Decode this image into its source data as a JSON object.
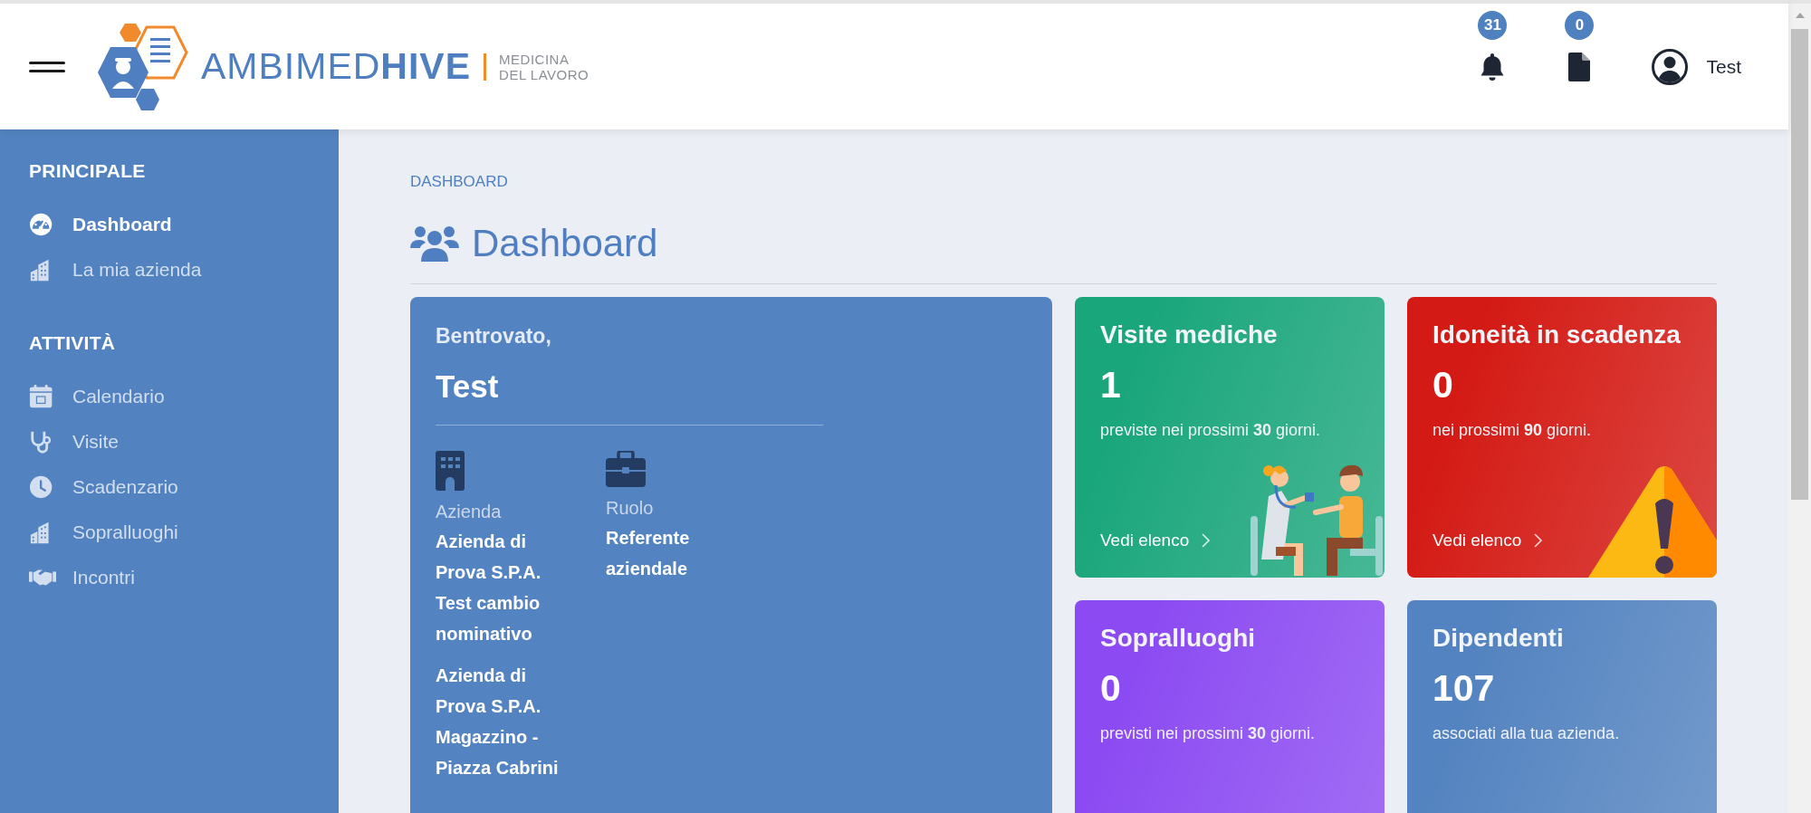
{
  "header": {
    "logo": {
      "brand_light": "AMBIMED",
      "brand_bold": "HIVE",
      "tagline_1": "MEDICINA",
      "tagline_2": "DEL LAVORO"
    },
    "notifications": {
      "count": "31"
    },
    "documents": {
      "count": "0"
    },
    "user": {
      "name": "Test"
    }
  },
  "sidebar": {
    "sections": [
      {
        "title": "PRINCIPALE",
        "items": [
          {
            "label": "Dashboard",
            "selected": true
          },
          {
            "label": "La mia azienda",
            "selected": false
          }
        ]
      },
      {
        "title": "ATTIVITÀ",
        "items": [
          {
            "label": "Calendario",
            "selected": false
          },
          {
            "label": "Visite",
            "selected": false
          },
          {
            "label": "Scadenzario",
            "selected": false
          },
          {
            "label": "Sopralluoghi",
            "selected": false
          },
          {
            "label": "Incontri",
            "selected": false
          }
        ]
      }
    ]
  },
  "breadcrumb": "DASHBOARD",
  "page_title": "Dashboard",
  "welcome": {
    "greeting": "Bentrovato,",
    "name": "Test",
    "columns": [
      {
        "label": "Azienda",
        "values": [
          "Azienda di Prova S.P.A. Test cambio nominativo",
          "Azienda di Prova S.P.A. Magazzino - Piazza Cabrini"
        ]
      },
      {
        "label": "Ruolo",
        "values": [
          "Referente aziendale"
        ]
      }
    ]
  },
  "cards": [
    {
      "kind": "visits",
      "title": "Visite mediche",
      "value": "1",
      "caption": "previste nei prossimi **30** giorni.",
      "link": "Vedi elenco",
      "color": "#1aa67b"
    },
    {
      "kind": "expiry",
      "title": "Idoneità in scadenza",
      "value": "0",
      "caption": "nei prossimi **90** giorni.",
      "link": "Vedi elenco",
      "color": "#d41a14"
    },
    {
      "kind": "inspections",
      "title": "Sopralluoghi",
      "value": "0",
      "caption": "previsti nei prossimi **30** giorni.",
      "color": "#8c4bf2"
    },
    {
      "kind": "employees",
      "title": "Dipendenti",
      "value": "107",
      "caption": "associati alla tua azienda.",
      "color": "#5383c0"
    }
  ]
}
